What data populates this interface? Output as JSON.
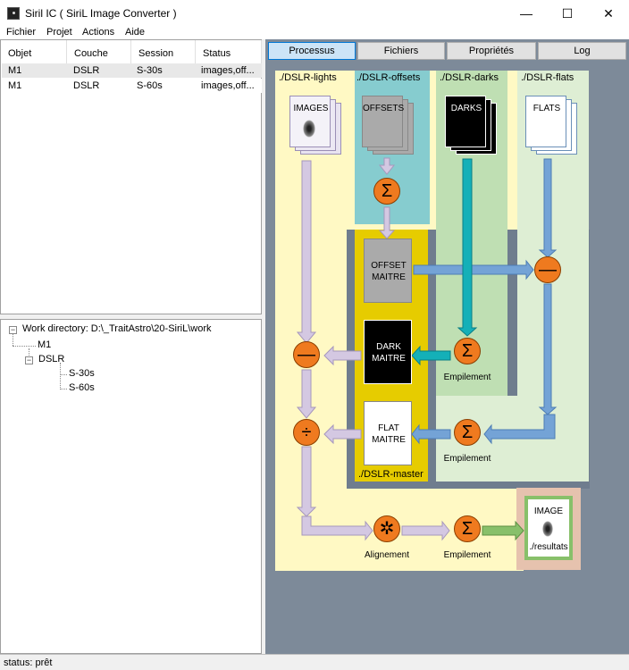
{
  "window": {
    "title": "Siril IC  ( SiriL Image Converter )",
    "minimize_glyph": "—",
    "maximize_glyph": "☐",
    "close_glyph": "✕"
  },
  "menu": {
    "items": [
      "Fichier",
      "Projet",
      "Actions",
      "Aide"
    ]
  },
  "table": {
    "columns": [
      "Objet",
      "Couche",
      "Session",
      "Status"
    ],
    "rows": [
      [
        "M1",
        "DSLR",
        "S-30s",
        "images,off..."
      ],
      [
        "M1",
        "DSLR",
        "S-60s",
        "images,off..."
      ]
    ]
  },
  "tree": {
    "root": "Work directory: D:\\_TraitAstro\\20-SiriL\\work",
    "object": "M1",
    "layer": "DSLR",
    "sessions": [
      "S-30s",
      "S-60s"
    ],
    "expander_glyph": "−"
  },
  "tabs": [
    {
      "label": "Processus",
      "active": true
    },
    {
      "label": "Fichiers",
      "active": false
    },
    {
      "label": "Propriétés",
      "active": false
    },
    {
      "label": "Log",
      "active": false
    }
  ],
  "diagram": {
    "regions": {
      "lights": "./DSLR-lights",
      "offsets": "./DSLR-offsets",
      "darks": "./DSLR-darks",
      "flats": "./DSLR-flats",
      "master": "./DSLR-master",
      "results": "./resultats"
    },
    "frames": {
      "images": "IMAGES",
      "offsets": "OFFSETS",
      "darks": "DARKS",
      "flats": "FLATS",
      "offset_master": [
        "OFFSET",
        "MAITRE"
      ],
      "dark_master": [
        "DARK",
        "MAITRE"
      ],
      "flat_master": [
        "FLAT",
        "MAITRE"
      ],
      "result_image": "IMAGE"
    },
    "ops": {
      "sum": "Σ",
      "minus": "—",
      "divide": "÷",
      "gear": "✲"
    },
    "labels": {
      "empilement": "Empilement",
      "alignement": "Alignement"
    }
  },
  "colors": {
    "lights_bg": "#fff9c4",
    "offsets_bg": "#86cccf",
    "darks_bg": "#bfdfb3",
    "flats_bg": "#deeed4",
    "master_bg": "#e6cc00",
    "result_bg": "#e6c2ae",
    "operator": "#ef7a1f",
    "arrow_lilac": "#d4c8e2",
    "arrow_blue": "#74a3d6",
    "arrow_teal": "#14b0b8",
    "arrow_green": "#88c06a",
    "tab_active": "#cce4f7",
    "panel_bg": "#7d8a99"
  },
  "status": "status: prêt"
}
